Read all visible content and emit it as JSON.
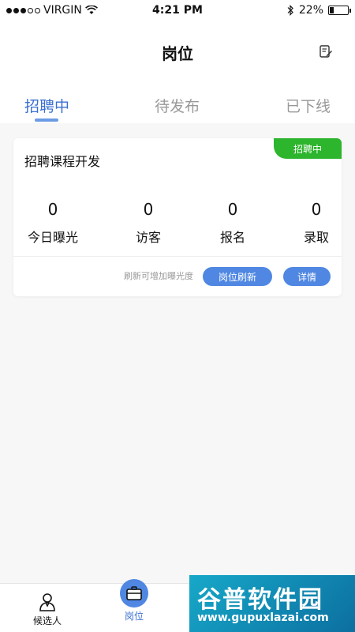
{
  "status_bar": {
    "carrier": "VIRGIN",
    "time": "4:21 PM",
    "battery": "22%",
    "battery_level": 0.22
  },
  "header": {
    "title": "岗位"
  },
  "tabs": [
    {
      "label": "招聘中",
      "active": true
    },
    {
      "label": "待发布",
      "active": false
    },
    {
      "label": "已下线",
      "active": false
    }
  ],
  "job_card": {
    "title": "招聘课程开发",
    "status": "招聘中",
    "status_color": "#2db52d",
    "stats": [
      {
        "value": "0",
        "label": "今日曝光"
      },
      {
        "value": "0",
        "label": "访客"
      },
      {
        "value": "0",
        "label": "报名"
      },
      {
        "value": "0",
        "label": "录取"
      }
    ],
    "hint": "刷新可增加曝光度",
    "refresh_button": "岗位刷新",
    "detail_button": "详情"
  },
  "bottom_nav": [
    {
      "label": "候选人",
      "icon": "person-icon"
    },
    {
      "label": "岗位",
      "icon": "briefcase-icon",
      "active": true
    }
  ],
  "watermark": {
    "title": "谷普软件园",
    "url": "www.gupuxlazai.com"
  },
  "colors": {
    "accent": "#3a6fd0",
    "button": "#4f87e2"
  }
}
